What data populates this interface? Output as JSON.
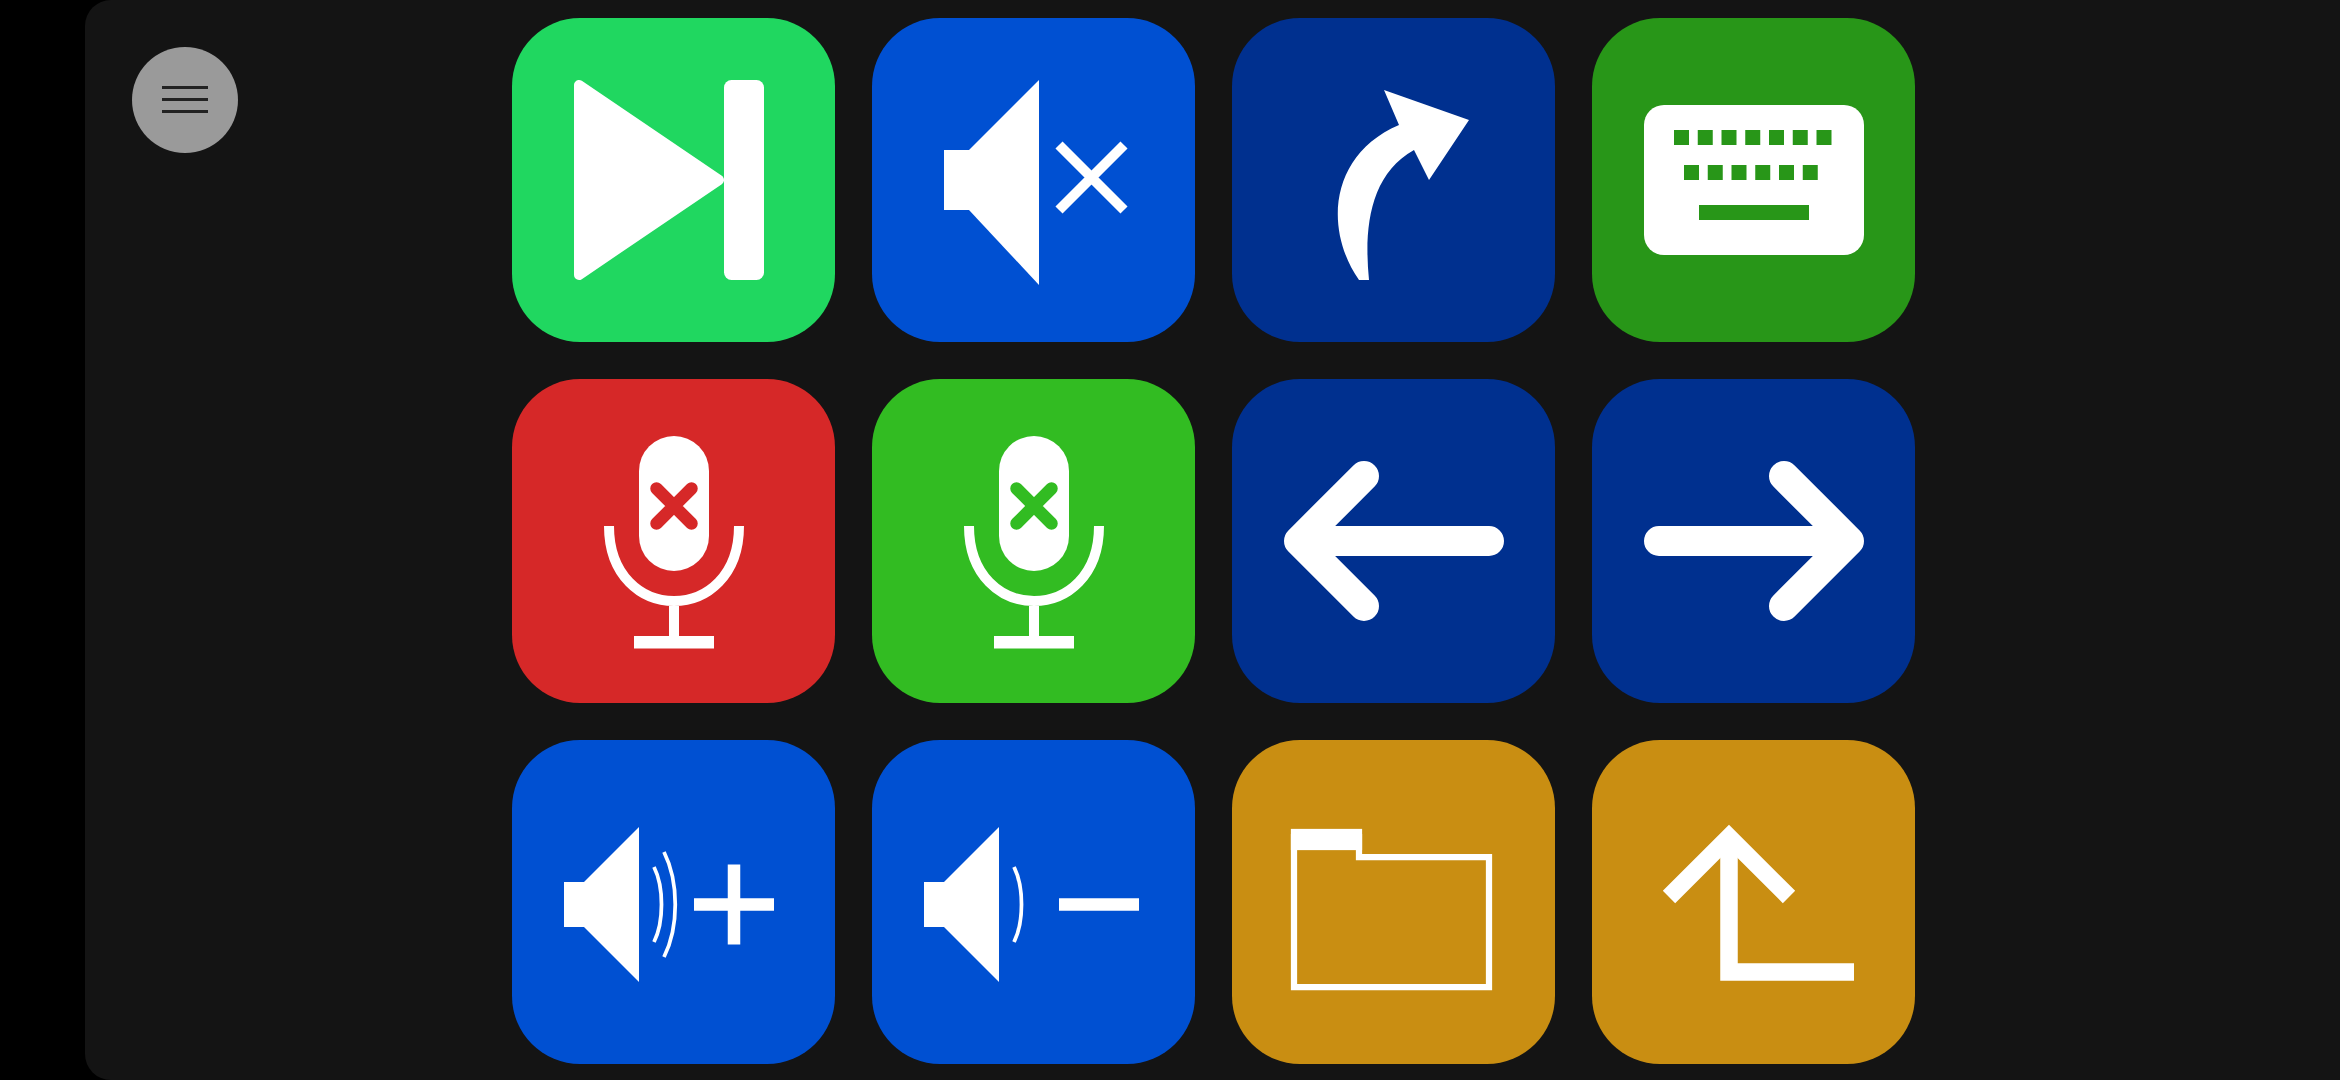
{
  "tiles": [
    {
      "kind": "skip-next",
      "color": "#20d760"
    },
    {
      "kind": "volume-mute",
      "color": "#0050d2"
    },
    {
      "kind": "curved-arrow",
      "color": "#00308f"
    },
    {
      "kind": "keyboard",
      "color": "#289618"
    },
    {
      "kind": "mic-off",
      "color": "#d62828"
    },
    {
      "kind": "mic-off",
      "color": "#32bc22"
    },
    {
      "kind": "arrow-left",
      "color": "#00308f"
    },
    {
      "kind": "arrow-right",
      "color": "#00308f"
    },
    {
      "kind": "volume-up",
      "color": "#0050d2"
    },
    {
      "kind": "volume-down",
      "color": "#0050d2"
    },
    {
      "kind": "folder",
      "color": "#c98e12"
    },
    {
      "kind": "turn-up",
      "color": "#c98e12"
    }
  ]
}
